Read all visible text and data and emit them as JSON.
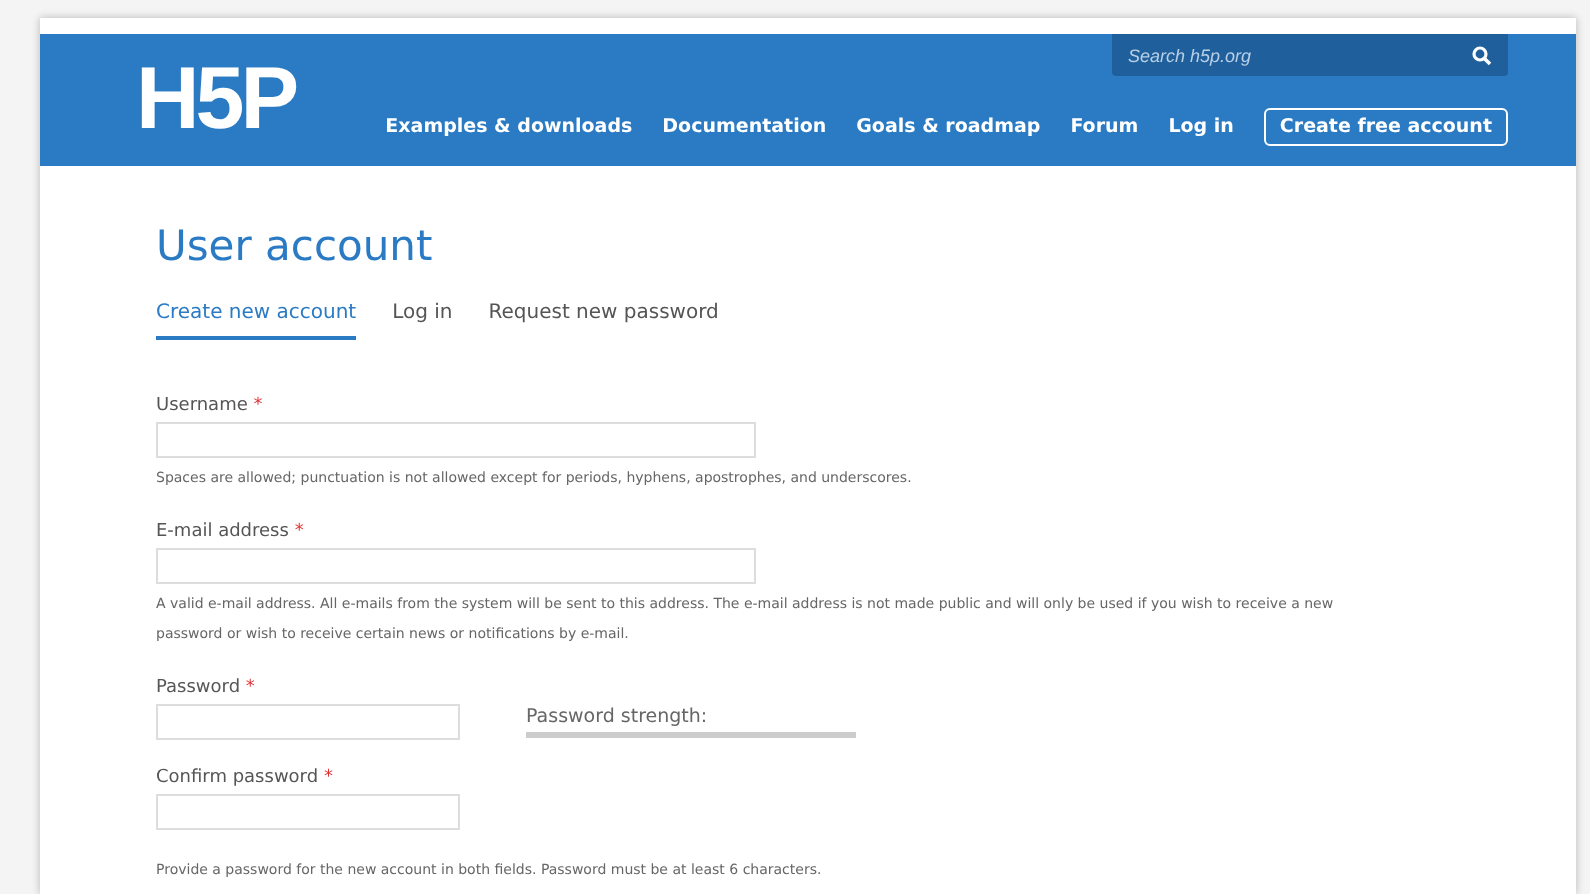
{
  "header": {
    "logo": "H5P",
    "search": {
      "placeholder": "Search h5p.org"
    },
    "nav": [
      {
        "label": "Examples & downloads",
        "kind": "link"
      },
      {
        "label": "Documentation",
        "kind": "link"
      },
      {
        "label": "Goals & roadmap",
        "kind": "link"
      },
      {
        "label": "Forum",
        "kind": "link"
      },
      {
        "label": "Log in",
        "kind": "link"
      },
      {
        "label": "Create free account",
        "kind": "outlined"
      }
    ]
  },
  "title": "User account",
  "tabs": [
    {
      "label": "Create new account",
      "selected": true
    },
    {
      "label": "Log in",
      "selected": false
    },
    {
      "label": "Request new password",
      "selected": false
    }
  ],
  "fields": [
    {
      "label": "Username",
      "required": "*",
      "kind": "wide",
      "help": "Spaces are allowed; punctuation is not allowed except for periods, hyphens, apostrophes, and underscores."
    },
    {
      "label": "E-mail address",
      "required": "*",
      "kind": "wide",
      "help": "A valid e-mail address. All e-mails from the system will be sent to this address. The e-mail address is not made public and will only be used if you wish to receive a new password or wish to receive certain news or notifications by e-mail."
    },
    {
      "label": "Password",
      "required": "*",
      "kind": "narrow",
      "strength": {
        "label": "Password strength:",
        "level": 0
      }
    },
    {
      "label": "Confirm password",
      "required": "*",
      "kind": "narrow"
    }
  ],
  "password_help": "Provide a password for the new account in both fields. Password must be at least 6 characters."
}
